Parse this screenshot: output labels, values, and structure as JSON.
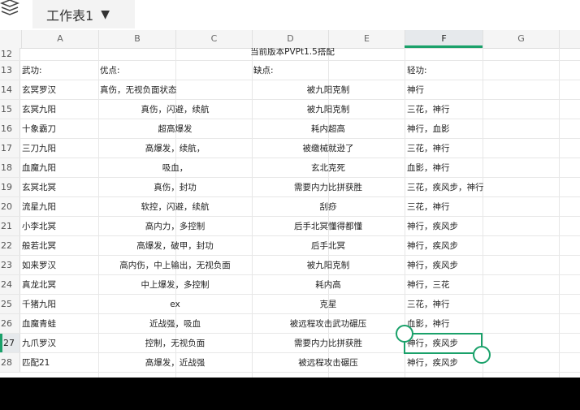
{
  "sheet_tab": {
    "label": "工作表1"
  },
  "columns": [
    "A",
    "B",
    "C",
    "D",
    "E",
    "F",
    "G"
  ],
  "selected_column": "F",
  "rows": [
    {
      "num": "12",
      "title": "当前版本PVPt1.5搭配"
    },
    {
      "num": "13",
      "a": "武功:",
      "b": "优点:",
      "d": "缺点:",
      "f": "轻功:",
      "left": true
    },
    {
      "num": "14",
      "a": "玄冥罗汉",
      "b": "真伤，无视负面状态",
      "d": "被九阳克制",
      "f": "神行",
      "b_left": true
    },
    {
      "num": "15",
      "a": "玄冥九阳",
      "b": "真伤，闪避，续航",
      "d": "被九阳克制",
      "f": "三花，神行"
    },
    {
      "num": "16",
      "a": "十象霸刀",
      "b": "超高爆发",
      "d": "耗内超高",
      "f": "神行，血影"
    },
    {
      "num": "17",
      "a": "三刀九阳",
      "b": "高爆发，续航，",
      "d": "被缴械就逊了",
      "f": "三花，神行"
    },
    {
      "num": "18",
      "a": "血魔九阳",
      "b": "吸血，",
      "d": "玄北克死",
      "f": "血影，神行"
    },
    {
      "num": "19",
      "a": "玄冥北冥",
      "b": "真伤，封功",
      "d": "需要内力比拼获胜",
      "f": "三花，疾风步，神行"
    },
    {
      "num": "20",
      "a": "流星九阳",
      "b": "软控，闪避，续航",
      "d": "刮痧",
      "f": "三花，神行"
    },
    {
      "num": "21",
      "a": "小李北冥",
      "b": "高内力，多控制",
      "d": "后手北冥懂得都懂",
      "f": "神行，疾风步"
    },
    {
      "num": "22",
      "a": "般若北冥",
      "b": "高爆发，破甲，封功",
      "d": "后手北冥",
      "f": "神行，疾风步"
    },
    {
      "num": "23",
      "a": "如来罗汉",
      "b": "高内伤，中上输出，无视负面",
      "d": "被九阳克制",
      "f": "神行，疾风步"
    },
    {
      "num": "24",
      "a": "真龙北冥",
      "b": "中上爆发，多控制",
      "d": "耗内高",
      "f": "神行，三花"
    },
    {
      "num": "25",
      "a": "千猪九阳",
      "b": "ex",
      "d": "克星",
      "f": "三花，神行"
    },
    {
      "num": "26",
      "a": "血魔青蛙",
      "b": "近战强，吸血",
      "d": "被远程攻击武功碾压",
      "f": "血影，神行"
    },
    {
      "num": "27",
      "a": "九爪罗汉",
      "b": "控制，无视负面",
      "d": "需要内力比拼获胜",
      "f": "神行，疾风步",
      "selected": true
    },
    {
      "num": "28",
      "a": "匹配21",
      "b": "高爆发，近战强",
      "d": "被远程攻击碾压",
      "f": "神行，疾风步"
    }
  ],
  "accent_color": "#1aa16a"
}
